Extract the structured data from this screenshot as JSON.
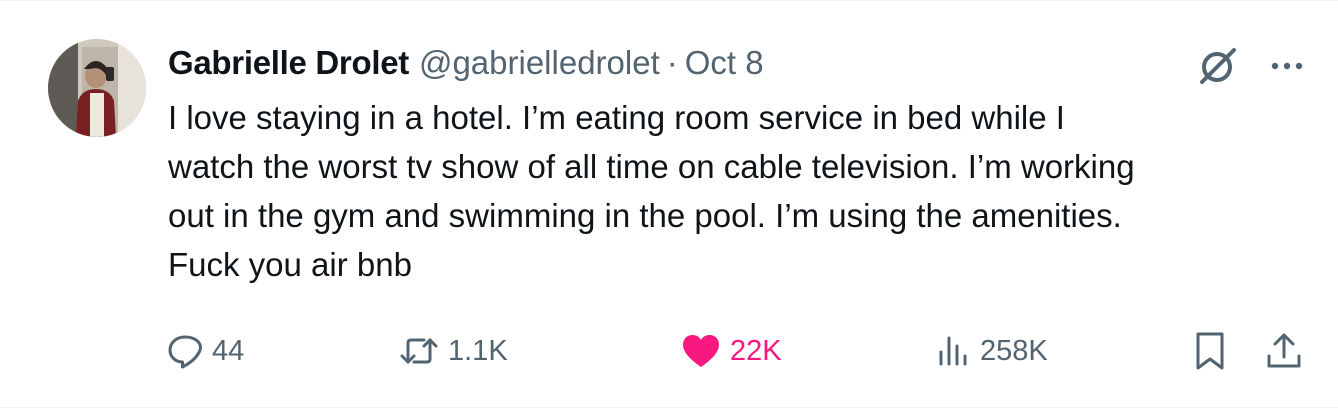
{
  "author": {
    "name": "Gabrielle Drolet",
    "handle": "@gabrielledrolet",
    "separator": "·",
    "date": "Oct 8"
  },
  "tweet": {
    "text": "I love staying in a hotel. I’m eating room service in bed while I\nwatch the worst tv show of all time on cable television. I’m working\nout in the gym and swimming in the pool. I’m using the amenities.\nFuck you air bnb"
  },
  "stats": {
    "replies": "44",
    "reposts": "1.1K",
    "likes": "22K",
    "views": "258K"
  },
  "icons": {
    "reply": "reply-icon",
    "repost": "repost-icon",
    "like": "heart-icon",
    "views": "views-icon",
    "bookmark": "bookmark-icon",
    "share": "share-icon",
    "grok": "grok-icon",
    "more": "more-icon"
  },
  "colors": {
    "text": "#0f1419",
    "secondary": "#536471",
    "like": "#f91880"
  }
}
